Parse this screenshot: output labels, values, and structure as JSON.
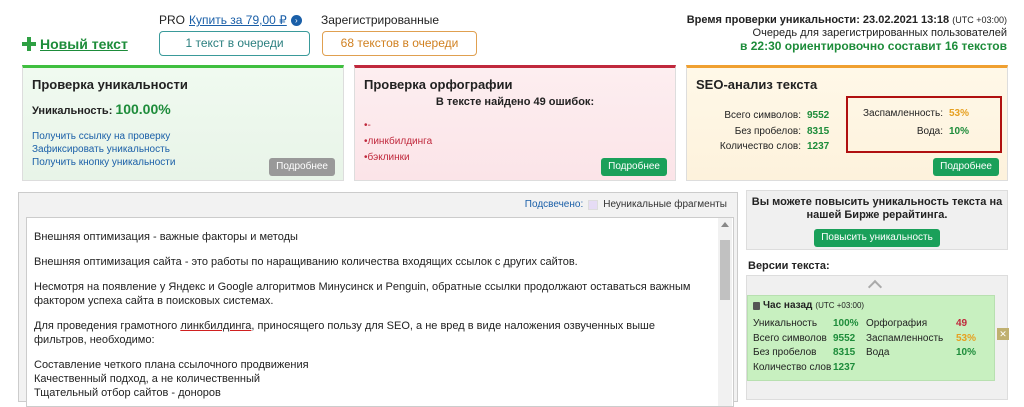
{
  "header": {
    "new_text": "Новый текст",
    "pro_label": "PRO",
    "pro_buy": "Купить за 79,00 ₽",
    "registered_label": "Зарегистрированные",
    "queue_pro": "1 текст в очереди",
    "queue_registered": "68 текстов в очереди",
    "check_time_label": "Время проверки уникальности: 23.02.2021 13:18",
    "check_time_tz": "(UTC +03:00)",
    "queue_info_1": "Очередь для зарегистрированных пользователей",
    "queue_info_2": "в 22:30 ориентировочно составит 16 текстов"
  },
  "uniqueness_card": {
    "title": "Проверка уникальности",
    "label": "Уникальность:",
    "value": "100.00%",
    "links": [
      "Получить ссылку на проверку",
      "Зафиксировать уникальность",
      "Получить кнопку уникальности"
    ],
    "more": "Подробнее"
  },
  "spelling_card": {
    "title": "Проверка орфографии",
    "found": "В тексте найдено 49 ошибок:",
    "errors": [
      "-",
      "линкбилдинга",
      "бэклинки"
    ],
    "more": "Подробнее"
  },
  "seo_card": {
    "title": "SEO-анализ текста",
    "rows": [
      {
        "label": "Всего символов:",
        "value": "9552"
      },
      {
        "label": "Без пробелов:",
        "value": "8315"
      },
      {
        "label": "Количество слов:",
        "value": "1237"
      }
    ],
    "spam_label": "Заспамленность:",
    "spam_value": "53%",
    "water_label": "Вода:",
    "water_value": "10%",
    "more": "Подробнее",
    "colors": {
      "spam": "#e6a020",
      "water": "#1d8c3a"
    }
  },
  "text_area": {
    "highlight_label": "Подсвечено:",
    "highlight_legend": "Неуникальные фрагменты",
    "p1": "Внешняя оптимизация - важные факторы и методы",
    "p2": "Внешняя оптимизация сайта - это работы по наращиванию количества входящих ссылок с других сайтов.",
    "p3": "Несмотря на появление у Яндекс и Google алгоритмов Минусинск и Penguin, обратные ссылки продолжают оставаться важным фактором успеха сайта в поисковых системах.",
    "p4_a": "Для проведения грамотного ",
    "p4_err": "линкбилдинга",
    "p4_b": ", приносящего пользу для SEO, а не вред в виде наложения озвученных выше фильтров, необходимо:",
    "l1": "Составление четкого плана ссылочного продвижения",
    "l2": "Качественный подход, а не количественный",
    "l3": "Тщательный отбор сайтов - доноров"
  },
  "promo": {
    "text": "Вы можете повысить уникальность текста на нашей Бирже рерайтинга.",
    "button": "Повысить уникальность"
  },
  "versions": {
    "label": "Версии текста:",
    "item": {
      "time": "Час назад",
      "tz": "(UTC +03:00)",
      "uniq_label": "Уникальность",
      "uniq": "100%",
      "spell_label": "Орфография",
      "spell": "49",
      "chars_label": "Всего символов",
      "chars": "9552",
      "spam_label": "Заспамленность",
      "spam": "53%",
      "nospace_label": "Без пробелов",
      "nospace": "8315",
      "water_label": "Вода",
      "water": "10%",
      "words_label": "Количество слов",
      "words": "1237"
    }
  }
}
